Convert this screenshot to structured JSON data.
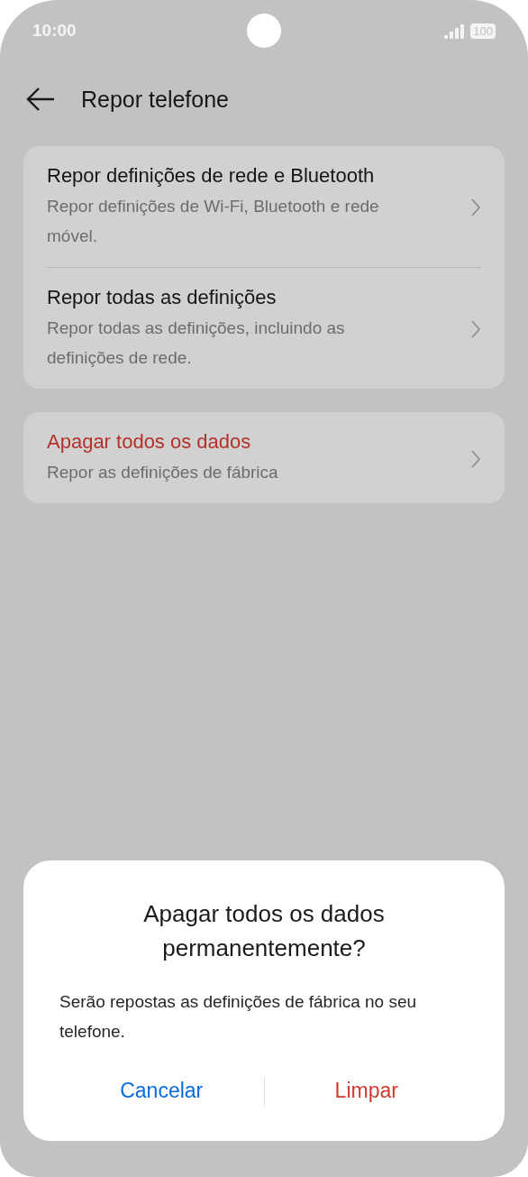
{
  "status_bar": {
    "time": "10:00",
    "battery": "100"
  },
  "header": {
    "title": "Repor telefone"
  },
  "groups": [
    {
      "items": [
        {
          "kind": "normal",
          "title": "Repor definições de rede e Bluetooth",
          "subtitle": "Repor definições de Wi-Fi, Bluetooth e rede móvel."
        },
        {
          "kind": "normal",
          "title": "Repor todas as definições",
          "subtitle": "Repor todas as definições, incluindo as definições de rede."
        }
      ]
    },
    {
      "items": [
        {
          "kind": "danger",
          "title": "Apagar todos os dados",
          "subtitle": "Repor as definições de fábrica"
        }
      ]
    }
  ],
  "dialog": {
    "title": "Apagar todos os dados permanentemente?",
    "message": "Serão repostas as definições de fábrica no seu telefone.",
    "buttons": [
      {
        "kind": "neutral",
        "label": "Cancelar"
      },
      {
        "kind": "danger",
        "label": "Limpar"
      }
    ]
  }
}
